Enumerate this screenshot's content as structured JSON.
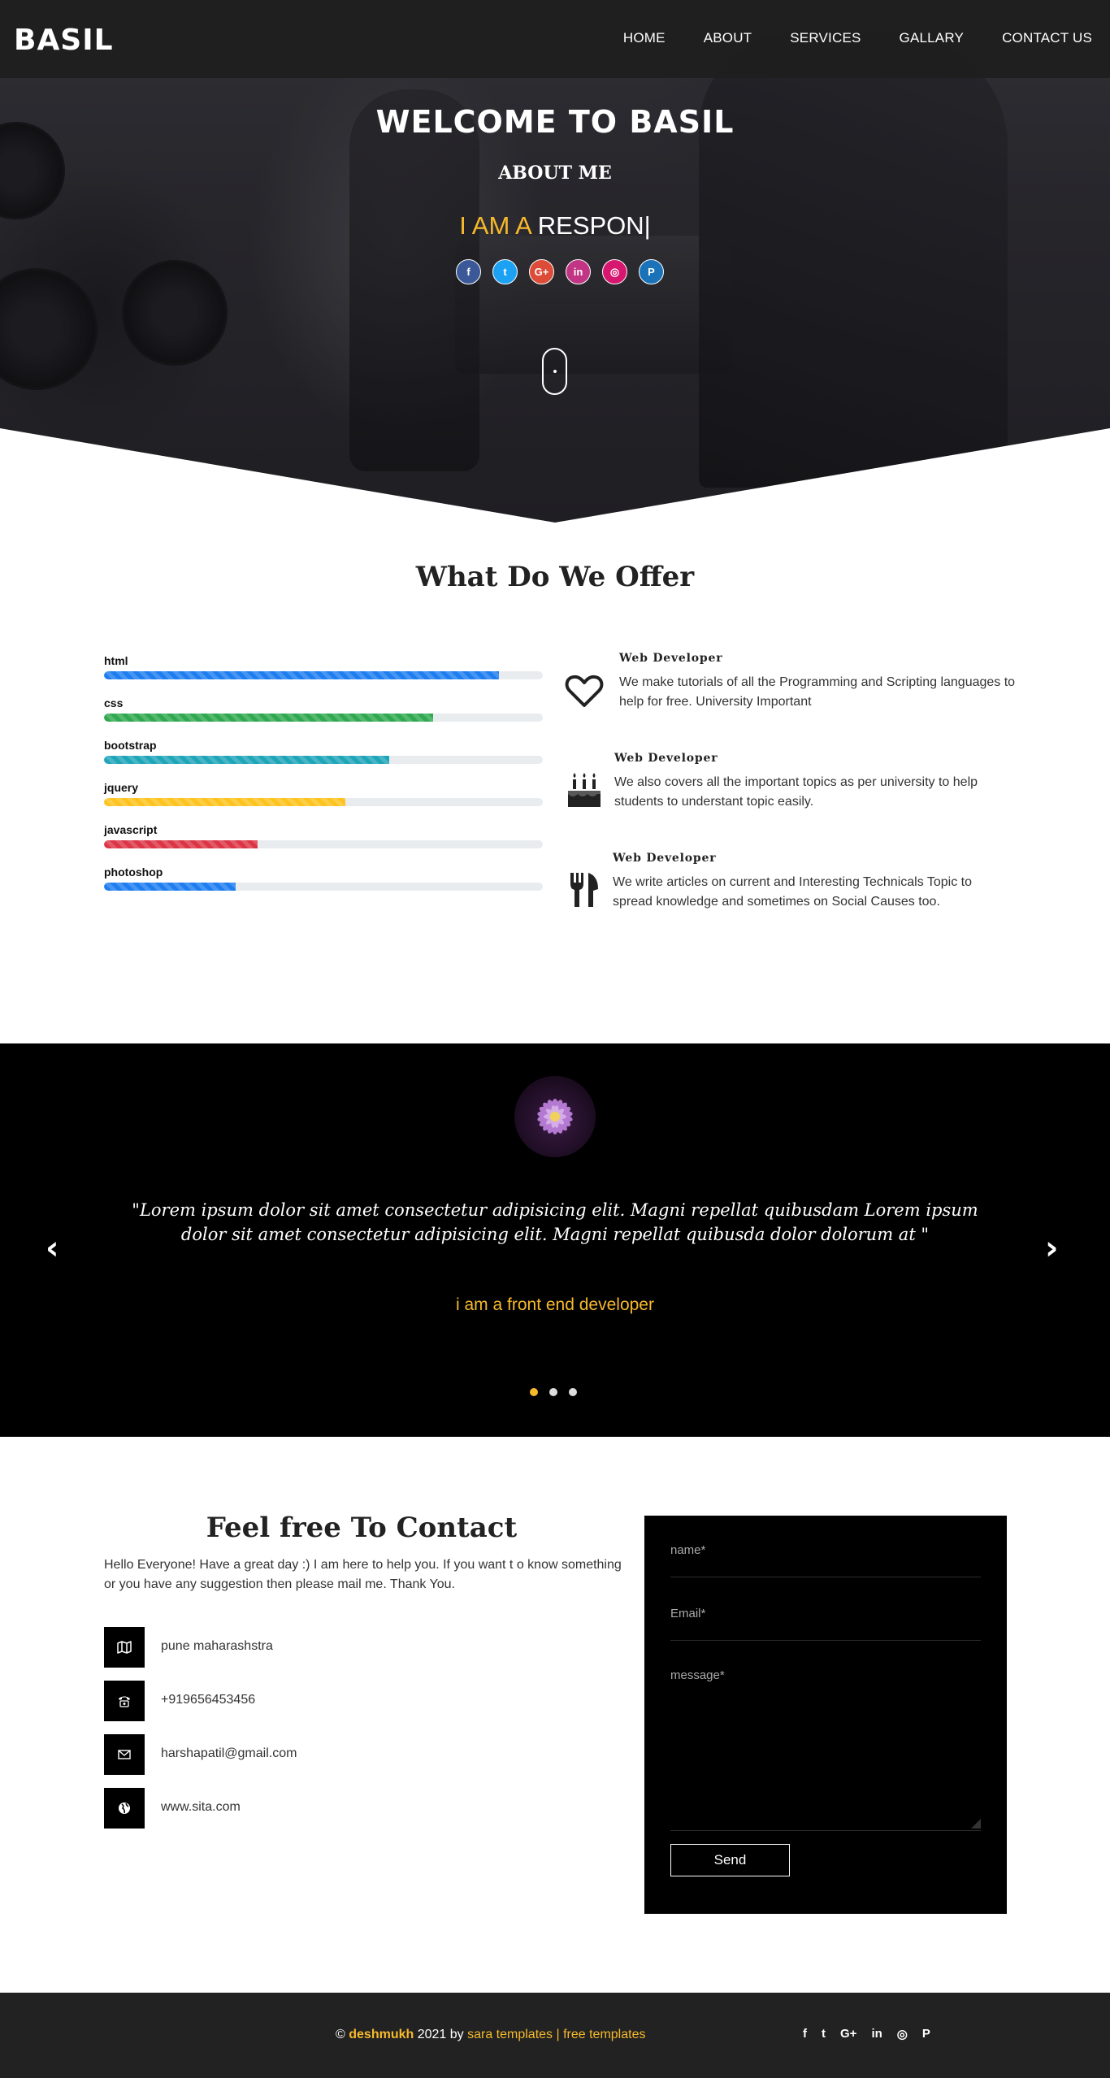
{
  "brand": {
    "logo": "BASIL"
  },
  "nav": {
    "items": [
      "HOME",
      "ABOUT",
      "SERVICES",
      "GALLARY",
      "CONTACT US"
    ]
  },
  "hero": {
    "title": "WELCOME TO BASIL",
    "subtitle": "ABOUT ME",
    "typed_prefix": "I AM A",
    "typed_text": "RESPON|",
    "social": [
      {
        "icon": "facebook-icon",
        "glyph": "f",
        "color": "#3b5998"
      },
      {
        "icon": "twitter-icon",
        "glyph": "t",
        "color": "#1da1f2"
      },
      {
        "icon": "google-plus-icon",
        "glyph": "G+",
        "color": "#dd4b39"
      },
      {
        "icon": "linkedin-icon",
        "glyph": "in",
        "color": "#c13584"
      },
      {
        "icon": "instagram-icon",
        "glyph": "◎",
        "color": "#d6166f"
      },
      {
        "icon": "pinterest-icon",
        "glyph": "P",
        "color": "#1a73b8"
      }
    ]
  },
  "offer": {
    "title": "What Do We Offer",
    "skills": [
      {
        "label": "html",
        "level": 0.9,
        "color": "#1e7ef0"
      },
      {
        "label": "css",
        "level": 0.75,
        "color": "#2fa84f"
      },
      {
        "label": "bootstrap",
        "level": 0.65,
        "color": "#1fa5b8"
      },
      {
        "label": "jquery",
        "level": 0.55,
        "color": "#ffc31f"
      },
      {
        "label": "javascript",
        "level": 0.35,
        "color": "#dc3545"
      },
      {
        "label": "photoshop",
        "level": 0.3,
        "color": "#1e7ef0"
      }
    ],
    "services": [
      {
        "icon": "heart-icon",
        "heading": "Web Developer",
        "text": "We make tutorials of all the Programming and Scripting languages to help for free. University Important"
      },
      {
        "icon": "birthday-cake-icon",
        "heading": "Web Developer",
        "text": "We also covers all the important topics as per university to help students to understant topic easily."
      },
      {
        "icon": "cutlery-icon",
        "heading": "Web Developer",
        "text": "We write articles on current and Interesting Technicals Topic to spread knowledge and sometimes on Social Causes too."
      }
    ]
  },
  "testimonial": {
    "quote": "\"Lorem ipsum dolor sit amet consectetur adipisicing elit. Magni repellat quibusdam Lorem ipsum dolor sit amet consectetur adipisicing elit. Magni repellat quibusda dolor dolorum at \"",
    "role": "i am a front end developer",
    "prev": "‹",
    "next": "›",
    "active_slide": 1,
    "slides": 3
  },
  "contact": {
    "title": "Feel free To Contact",
    "intro": "Hello Everyone! Have a great day :) I am here to help you. If you want t o know something or you have any suggestion then please mail me. Thank You.",
    "items": [
      {
        "icon": "map-icon",
        "text": "pune maharashstra"
      },
      {
        "icon": "phone-icon",
        "text": "+919656453456"
      },
      {
        "icon": "envelope-icon",
        "text": "harshapatil@gmail.com"
      },
      {
        "icon": "globe-icon",
        "text": "www.sita.com"
      }
    ],
    "form": {
      "name_placeholder": "name*",
      "email_placeholder": "Email*",
      "message_placeholder": "message*",
      "send_label": "Send"
    }
  },
  "footer": {
    "copyright_symbol": "©",
    "author": "deshmukh",
    "year_by": " 2021 by ",
    "links": "sara templates | free templates",
    "social": [
      "f",
      "t",
      "G+",
      "in",
      "◎",
      "P"
    ]
  }
}
